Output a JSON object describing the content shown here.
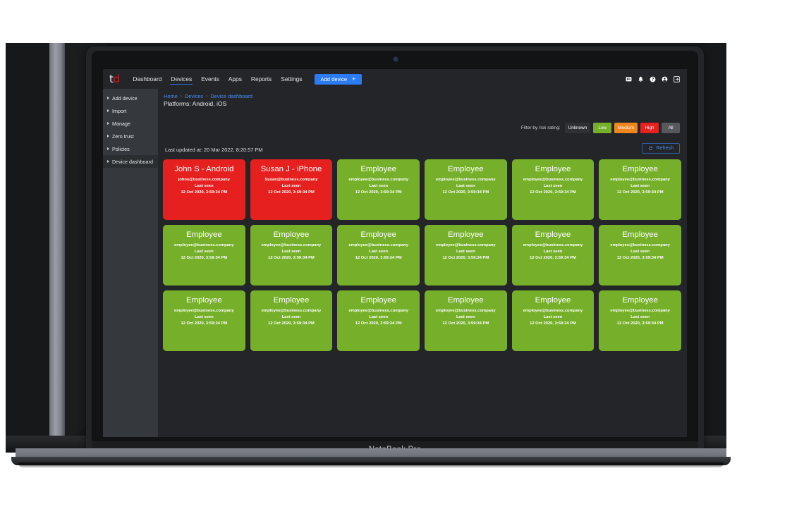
{
  "device": {
    "model_label": "NoteBook Pro"
  },
  "app": {
    "logo": {
      "part1": "t",
      "part2": "d"
    },
    "nav": [
      {
        "label": "Dashboard",
        "active": false
      },
      {
        "label": "Devices",
        "active": true
      },
      {
        "label": "Events",
        "active": false
      },
      {
        "label": "Apps",
        "active": false
      },
      {
        "label": "Reports",
        "active": false
      },
      {
        "label": "Settings",
        "active": false
      }
    ],
    "add_device_button": {
      "label": "Add device",
      "plus": "+",
      "color": "#2b7bf3"
    },
    "nav_icons": [
      {
        "name": "messages-icon"
      },
      {
        "name": "bell-icon"
      },
      {
        "name": "help-icon"
      },
      {
        "name": "account-icon"
      },
      {
        "name": "logout-icon"
      }
    ]
  },
  "sidebar": {
    "items": [
      {
        "label": "Add device",
        "active": false
      },
      {
        "label": "Import",
        "active": false
      },
      {
        "label": "Manage",
        "active": false
      },
      {
        "label": "Zero trust",
        "active": false
      },
      {
        "label": "Policies",
        "active": false
      },
      {
        "label": "Device dashboard",
        "active": true
      }
    ]
  },
  "main": {
    "breadcrumb": [
      {
        "label": "Home"
      },
      {
        "label": "Devices"
      },
      {
        "label": "Device dashboard"
      }
    ],
    "breadcrumb_separator": "›",
    "platforms": "Platforms: Android, iOS",
    "last_updated": "Last updated at: 20 Mar 2022, 8:20:57 PM",
    "filter_label": "Filter by risk rating:",
    "filters": [
      {
        "label": "Unknown",
        "color": "#2e3134"
      },
      {
        "label": "Low",
        "color": "#76b02b"
      },
      {
        "label": "Medium",
        "color": "#f0861e"
      },
      {
        "label": "High",
        "color": "#e6201f"
      },
      {
        "label": "All",
        "color": "#55585c"
      }
    ],
    "refresh_button": {
      "label": "Refresh",
      "icon": "refresh-icon",
      "color": "#4b8ef0"
    }
  },
  "cards": [
    {
      "title": "John S - Android",
      "email": "johns@business.company",
      "last_seen_label": "Last seen",
      "timestamp": "12 Oct 2020, 3:59:34 PM",
      "risk": "high"
    },
    {
      "title": "Susan J - iPhone",
      "email": "Susan@business.company",
      "last_seen_label": "Last seen",
      "timestamp": "12 Oct 2020, 3:59:34 PM",
      "risk": "high"
    },
    {
      "title": "Employee",
      "email": "employee@business.company",
      "last_seen_label": "Last seen",
      "timestamp": "12 Oct 2020, 3:59:34 PM",
      "risk": "low"
    },
    {
      "title": "Employee",
      "email": "employee@business.company",
      "last_seen_label": "Last seen",
      "timestamp": "12 Oct 2020, 3:59:34 PM",
      "risk": "low"
    },
    {
      "title": "Employee",
      "email": "employee@business.company",
      "last_seen_label": "Last seen",
      "timestamp": "12 Oct 2020, 3:59:34 PM",
      "risk": "low"
    },
    {
      "title": "Employee",
      "email": "employee@business.company",
      "last_seen_label": "Last seen",
      "timestamp": "12 Oct 2020, 3:59:34 PM",
      "risk": "low"
    },
    {
      "title": "Employee",
      "email": "employee@business.company",
      "last_seen_label": "Last seen",
      "timestamp": "12 Oct 2020, 3:59:34 PM",
      "risk": "low"
    },
    {
      "title": "Employee",
      "email": "employee@business.company",
      "last_seen_label": "Last seen",
      "timestamp": "12 Oct 2020, 3:59:34 PM",
      "risk": "low"
    },
    {
      "title": "Employee",
      "email": "employee@business.company",
      "last_seen_label": "Last seen",
      "timestamp": "12 Oct 2020, 3:59:34 PM",
      "risk": "low"
    },
    {
      "title": "Employee",
      "email": "employee@business.company",
      "last_seen_label": "Last seen",
      "timestamp": "12 Oct 2020, 3:59:34 PM",
      "risk": "low"
    },
    {
      "title": "Employee",
      "email": "employee@business.company",
      "last_seen_label": "Last seen",
      "timestamp": "12 Oct 2020, 3:59:34 PM",
      "risk": "low"
    },
    {
      "title": "Employee",
      "email": "employee@business.company",
      "last_seen_label": "Last seen",
      "timestamp": "12 Oct 2020, 3:59:34 PM",
      "risk": "low"
    },
    {
      "title": "Employee",
      "email": "employee@business.company",
      "last_seen_label": "Last seen",
      "timestamp": "12 Oct 2020, 3:59:34 PM",
      "risk": "low"
    },
    {
      "title": "Employee",
      "email": "employee@business.company",
      "last_seen_label": "Last seen",
      "timestamp": "12 Oct 2020, 3:59:34 PM",
      "risk": "low"
    },
    {
      "title": "Employee",
      "email": "employee@business.company",
      "last_seen_label": "Last seen",
      "timestamp": "12 Oct 2020, 3:59:34 PM",
      "risk": "low"
    },
    {
      "title": "Employee",
      "email": "employee@business.company",
      "last_seen_label": "Last seen",
      "timestamp": "12 Oct 2020, 3:59:34 PM",
      "risk": "low"
    },
    {
      "title": "Employee",
      "email": "employee@business.company",
      "last_seen_label": "Last seen",
      "timestamp": "12 Oct 2020, 3:59:34 PM",
      "risk": "low"
    },
    {
      "title": "Employee",
      "email": "employee@business.company",
      "last_seen_label": "Last seen",
      "timestamp": "12 Oct 2020, 3:59:34 PM",
      "risk": "low"
    }
  ]
}
